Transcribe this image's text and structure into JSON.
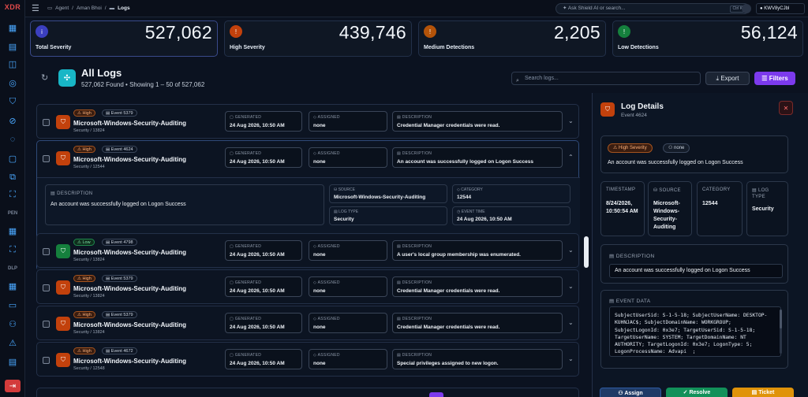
{
  "app": {
    "name": "XDR"
  },
  "rail": {
    "sections": [
      "PEN",
      "DLP"
    ]
  },
  "breadcrumbs": [
    "Agent",
    "Aman Bhoi",
    "Logs"
  ],
  "topbar": {
    "ai_placeholder": "Ask Shield AI or search...",
    "shortcut": "Ctrl K",
    "user": "KWV8yCJbl"
  },
  "stats": [
    {
      "label": "Total Severity",
      "value": "527,062",
      "color": "#3b3fbf",
      "icon": "info-icon"
    },
    {
      "label": "High Severity",
      "value": "439,746",
      "color": "#c2410c",
      "icon": "warning-icon"
    },
    {
      "label": "Medium Detections",
      "value": "2,205",
      "color": "#b45309",
      "icon": "warning-icon"
    },
    {
      "label": "Low Detections",
      "value": "56,124",
      "color": "#15803d",
      "icon": "warning-icon"
    }
  ],
  "header": {
    "title": "All Logs",
    "found": "527,062 Found",
    "showing": "Showing 1 – 50 of 527,062",
    "search_placeholder": "Search logs...",
    "export": "Export",
    "filters": "Filters"
  },
  "field_labels": {
    "generated": "GENERATED",
    "assigned": "ASSIGNED",
    "description": "DESCRIPTION"
  },
  "logs": [
    {
      "severity": "High",
      "event": "Event 5379",
      "title": "Microsoft-Windows-Security-Auditing",
      "meta": "Security / 13824",
      "generated": "24 Aug 2026, 10:50 AM",
      "assigned": "none",
      "description": "Credential Manager credentials were read."
    },
    {
      "severity": "High",
      "event": "Event 4624",
      "title": "Microsoft-Windows-Security-Auditing",
      "meta": "Security / 12544",
      "generated": "24 Aug 2026, 10:50 AM",
      "assigned": "none",
      "description": "An account was successfully logged on Logon Success"
    },
    {
      "severity": "Low",
      "event": "Event 4798",
      "title": "Microsoft-Windows-Security-Auditing",
      "meta": "Security / 13824",
      "generated": "24 Aug 2026, 10:50 AM",
      "assigned": "none",
      "description": "A user's local group membership was enumerated."
    },
    {
      "severity": "High",
      "event": "Event 5379",
      "title": "Microsoft-Windows-Security-Auditing",
      "meta": "Security / 13824",
      "generated": "24 Aug 2026, 10:50 AM",
      "assigned": "none",
      "description": "Credential Manager credentials were read."
    },
    {
      "severity": "High",
      "event": "Event 5379",
      "title": "Microsoft-Windows-Security-Auditing",
      "meta": "Security / 13824",
      "generated": "24 Aug 2026, 10:50 AM",
      "assigned": "none",
      "description": "Credential Manager credentials were read."
    },
    {
      "severity": "High",
      "event": "Event 4672",
      "title": "Microsoft-Windows-Security-Auditing",
      "meta": "Security / 12548",
      "generated": "24 Aug 2026, 10:50 AM",
      "assigned": "none",
      "description": "Special privileges assigned to new logon."
    }
  ],
  "expanded": {
    "description_label": "DESCRIPTION",
    "description": "An account was successfully logged on Logon Success",
    "source_label": "SOURCE",
    "source": "Microsoft-Windows-Security-Auditing",
    "category_label": "CATEGORY",
    "category": "12544",
    "logtype_label": "LOG TYPE",
    "logtype": "Security",
    "eventtime_label": "EVENT TIME",
    "eventtime": "24 Aug 2026, 10:50 AM"
  },
  "panel": {
    "title": "Log Details",
    "subtitle": "Event 4624",
    "severity_pill": "High Severity",
    "assignee_pill": "none",
    "summary": "An account was successfully logged on Logon Success",
    "timestamp_label": "TIMESTAMP",
    "timestamp": "8/24/2026, 10:50:54 AM",
    "source_label": "SOURCE",
    "source": "Microsoft-Windows-Security-Auditing",
    "category_label": "CATEGORY",
    "category": "12544",
    "logtype_label": "LOG TYPE",
    "logtype": "Security",
    "description_label": "DESCRIPTION",
    "description": "An account was successfully logged on Logon Success",
    "eventdata_label": "EVENT DATA",
    "eventdata": "SubjectUserSid: S-1-5-18; SubjectUserName: DESKTOP-KUHNJAC$; SubjectDomainName: WORKGROUP; SubjectLogonId: 0x3e7; TargetUserSid: S-1-5-18; TargetUserName: SYSTEM; TargetDomainName: NT AUTHORITY; TargetLogonId: 0x3e7; LogonType: 5; LogonProcessName: Advapi  ; AuthenticationPackageName: Negotiate;",
    "assign": "Assign",
    "resolve": "Resolve",
    "ticket": "Ticket"
  }
}
